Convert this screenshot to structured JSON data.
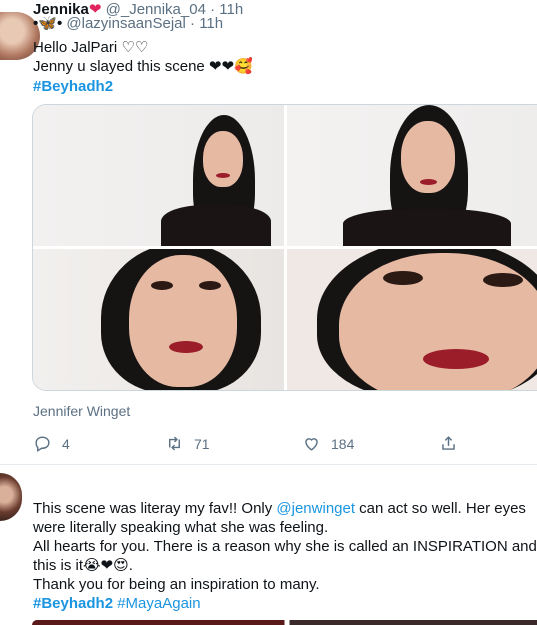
{
  "tweets": [
    {
      "display_name": "🦋",
      "handle": "@lazyinsaanSejal",
      "separator": "·",
      "time": "11h",
      "lines": [
        "Hello JalPari ♡♡",
        "Jenny u slayed this scene ❤❤🥰"
      ],
      "hashtags": [
        "#Beyhadh2"
      ],
      "media_caption": "Jennifer Winget",
      "actions": {
        "replies": "4",
        "retweets": "71",
        "likes": "184"
      }
    },
    {
      "display_name": "Jennika",
      "name_heart": "❤",
      "handle": "@_Jennika_04",
      "separator": "·",
      "time": "11h",
      "line1_a": "This scene was literay my fav!! Only ",
      "mention": "@jenwinget",
      "line1_b": " can act so well. Her eyes",
      "line2": "were literally speaking what she was feeling.",
      "line3": "All hearts for you. There is a reason why she is called an INSPIRATION and",
      "line4": "this is it😭❤😍.",
      "line5": "Thank you for being an inspiration to many.",
      "hashtags": [
        "#Beyhadh2",
        "#MayaAgain"
      ]
    }
  ],
  "colors": {
    "link": "#1b95e0",
    "muted": "#5b7083",
    "heart": "#e0245e",
    "border": "#ccd6dd"
  },
  "icons": [
    "reply-icon",
    "retweet-icon",
    "like-icon",
    "share-icon"
  ]
}
